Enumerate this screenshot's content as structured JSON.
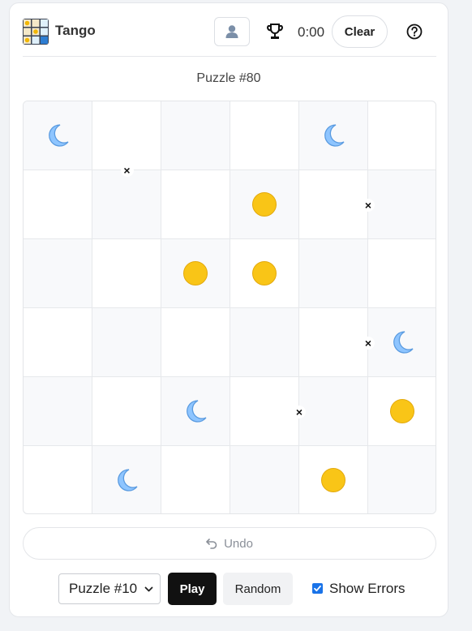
{
  "app": {
    "title": "Tango"
  },
  "header": {
    "timer": "0:00",
    "clear_label": "Clear",
    "icons": [
      "avatar-icon",
      "trophy-icon",
      "help-circle-icon"
    ]
  },
  "puzzle": {
    "title": "Puzzle #80",
    "grid": [
      [
        "moon",
        "",
        "",
        "",
        "moon",
        ""
      ],
      [
        "",
        "",
        "",
        "sun",
        "",
        ""
      ],
      [
        "",
        "",
        "sun",
        "sun",
        "",
        ""
      ],
      [
        "",
        "",
        "",
        "",
        "",
        "moon"
      ],
      [
        "",
        "",
        "moon",
        "",
        "",
        "sun"
      ],
      [
        "",
        "moon",
        "",
        "",
        "sun",
        ""
      ]
    ],
    "constraints": [
      {
        "type": "x",
        "between": [
          [
            0,
            1
          ],
          [
            1,
            1
          ]
        ]
      },
      {
        "type": "x",
        "between": [
          [
            1,
            4
          ],
          [
            1,
            5
          ]
        ]
      },
      {
        "type": "x",
        "between": [
          [
            3,
            4
          ],
          [
            3,
            5
          ]
        ]
      },
      {
        "type": "x",
        "between": [
          [
            4,
            3
          ],
          [
            4,
            4
          ]
        ]
      }
    ],
    "constraint_symbol": "×"
  },
  "controls": {
    "undo_label": "Undo",
    "select_value": "Puzzle #10",
    "play_label": "Play",
    "random_label": "Random",
    "show_errors_label": "Show Errors",
    "show_errors_checked": true
  },
  "colors": {
    "sun": "#f9c517",
    "moon": "#8ec5ff",
    "accent": "#1a73e8",
    "play_bg": "#111111"
  }
}
